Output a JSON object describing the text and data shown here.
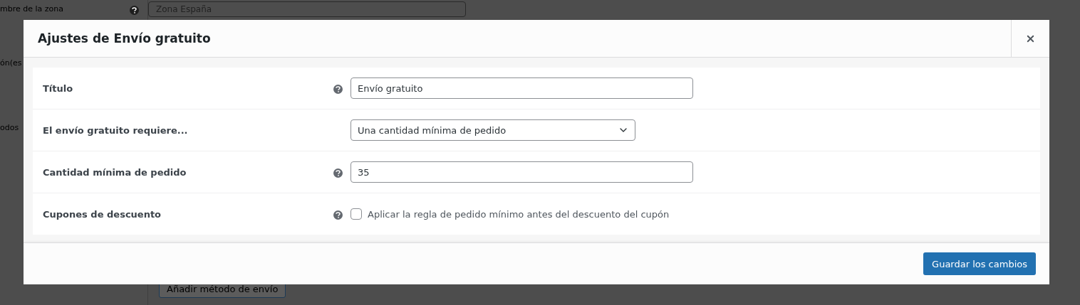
{
  "background_page": {
    "zone_label": "mbre de la zona",
    "zone_help": true,
    "zone_value": "Zona España",
    "labels": [
      "ón(es",
      "odos"
    ],
    "add_button": "Añadir método de envío"
  },
  "modal": {
    "title": "Ajustes de Envío gratuito",
    "rows": [
      {
        "kind": "text",
        "label": "Título",
        "help": true,
        "value": "Envío gratuito"
      },
      {
        "kind": "select",
        "label": "El envío gratuito requiere...",
        "help": false,
        "value": "Una cantidad mínima de pedido"
      },
      {
        "kind": "text",
        "label": "Cantidad mínima de pedido",
        "help": true,
        "value": "35"
      },
      {
        "kind": "checkbox",
        "label": "Cupones de descuento",
        "help": true,
        "checked": false,
        "text": "Aplicar la regla de pedido mínimo antes del descuento del cupón"
      }
    ],
    "save_button": "Guardar los cambios"
  }
}
